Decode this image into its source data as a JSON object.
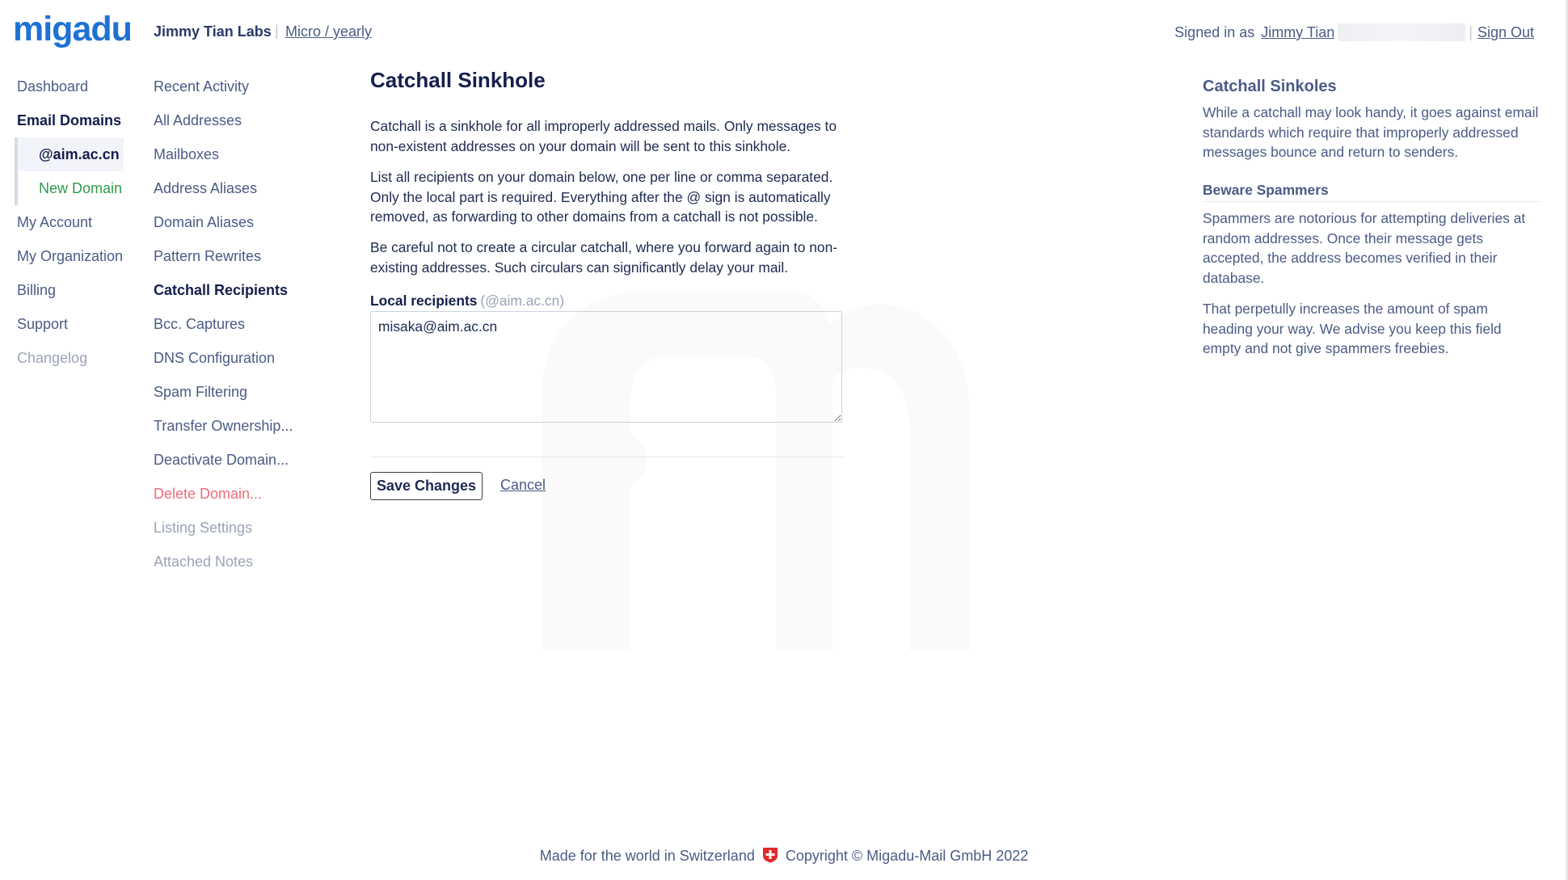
{
  "header": {
    "logo_text": "migadu",
    "org_name": "Jimmy Tian Labs",
    "plan": "Micro / yearly",
    "signed_in_label": "Signed in as",
    "user_name": "Jimmy Tian",
    "sign_out": "Sign Out"
  },
  "nav_primary": {
    "dashboard": "Dashboard",
    "email_domains": "Email Domains",
    "domain_current": "@aim.ac.cn",
    "new_domain": "New Domain",
    "my_account": "My Account",
    "my_organization": "My Organization",
    "billing": "Billing",
    "support": "Support",
    "changelog": "Changelog"
  },
  "nav_secondary": {
    "recent_activity": "Recent Activity",
    "all_addresses": "All Addresses",
    "mailboxes": "Mailboxes",
    "address_aliases": "Address Aliases",
    "domain_aliases": "Domain Aliases",
    "pattern_rewrites": "Pattern Rewrites",
    "catchall_recipients": "Catchall Recipients",
    "bcc_captures": "Bcc. Captures",
    "dns_configuration": "DNS Configuration",
    "spam_filtering": "Spam Filtering",
    "transfer_ownership": "Transfer Ownership...",
    "deactivate_domain": "Deactivate Domain...",
    "delete_domain": "Delete Domain...",
    "listing_settings": "Listing Settings",
    "attached_notes": "Attached Notes"
  },
  "main": {
    "title": "Catchall Sinkhole",
    "para1": "Catchall is a sinkhole for all improperly addressed mails. Only messages to non-existent addresses on your domain will be sent to this sinkhole.",
    "para2": "List all recipients on your domain below, one per line or comma separated. Only the local part is required. Everything after the @ sign is automatically removed, as forwarding to other domains from a catchall is not possible.",
    "para3": "Be careful not to create a circular catchall, where you forward again to non-existing addresses. Such circulars can significantly delay your mail.",
    "field_label": "Local recipients",
    "field_hint": "(@aim.ac.cn)",
    "field_value": "misaka@aim.ac.cn",
    "save_label": "Save Changes",
    "cancel_label": "Cancel"
  },
  "help": {
    "title": "Catchall Sinkoles",
    "p1": "While a catchall may look handy, it goes against email standards which require that improperly addressed messages bounce and return to senders.",
    "subtitle": "Beware Spammers",
    "p2": "Spammers are notorious for attempting deliveries at random addresses. Once their message gets accepted, the address becomes verified in their database.",
    "p3": "That perpetully increases the amount of spam heading your way. We advise you keep this field empty and not give spammers freebies."
  },
  "footer": {
    "made_in": "Made for the world in Switzerland",
    "copyright": "Copyright © Migadu-Mail GmbH 2022"
  },
  "colors": {
    "brand": "#1f72d4",
    "text": "#1f2a52",
    "muted": "#4a5b85",
    "success": "#2e9a4b",
    "danger": "#f06a78"
  }
}
